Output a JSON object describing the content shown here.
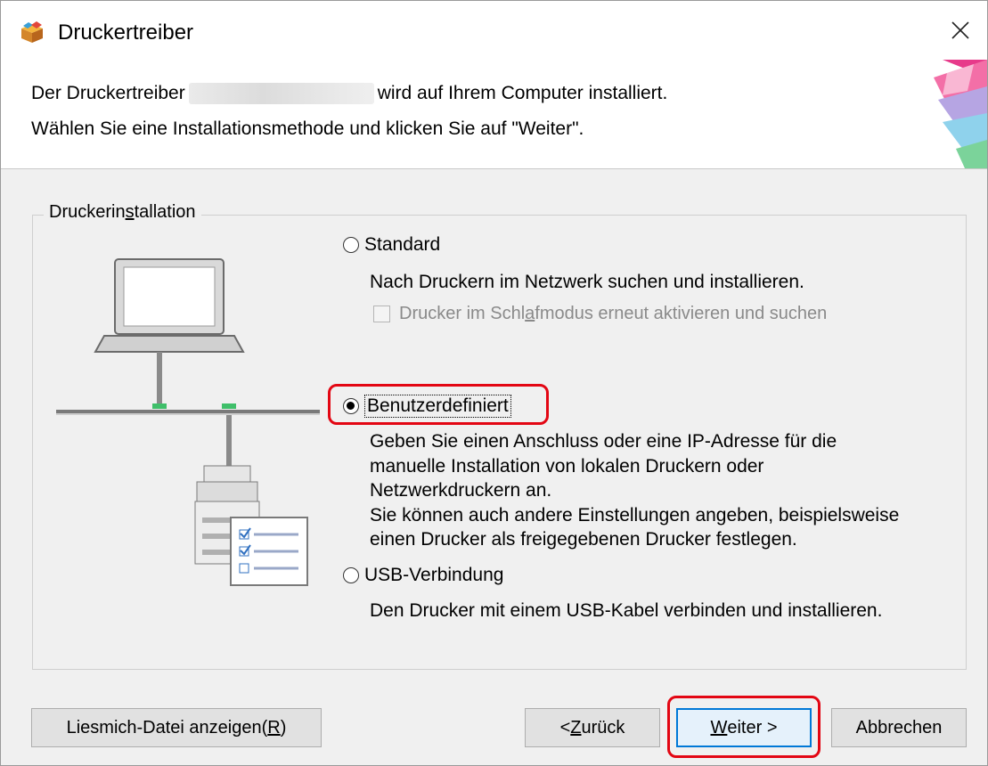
{
  "window": {
    "title": "Druckertreiber",
    "close_glyph": "×"
  },
  "header": {
    "line1_before": "Der Druckertreiber",
    "line1_after": "wird auf Ihrem Computer installiert.",
    "line2": "Wählen Sie eine Installationsmethode und klicken Sie auf \"Weiter\"."
  },
  "group": {
    "label_pre": "Druckerin",
    "label_mnemonic": "s",
    "label_post": "tallation",
    "options": [
      {
        "label": "Standard",
        "selected": false,
        "description": [
          "Nach Druckern im Netzwerk suchen und installieren."
        ],
        "checkbox": {
          "label_pre": "Drucker im Schl",
          "label_mnemonic": "a",
          "label_post": "fmodus erneut aktivieren und suchen",
          "checked": false,
          "enabled": false
        }
      },
      {
        "label": "Benutzerdefiniert",
        "selected": true,
        "description": [
          "Geben Sie einen Anschluss oder eine IP-Adresse für die",
          "manuelle Installation von lokalen Druckern oder",
          "Netzwerkdruckern an.",
          "Sie können auch andere Einstellungen angeben, beispielsweise",
          "einen Drucker als freigegebenen Drucker festlegen."
        ]
      },
      {
        "label": "USB-Verbindung",
        "selected": false,
        "description": [
          "Den Drucker mit einem USB-Kabel verbinden und installieren."
        ]
      }
    ]
  },
  "buttons": {
    "readme_pre": "Liesmich-Datei anzeigen(",
    "readme_mnemonic": "R",
    "readme_post": ")",
    "back_pre": "< ",
    "back_mnemonic": "Z",
    "back_post": "urück",
    "next_mnemonic": "W",
    "next_post": "eiter >",
    "cancel": "Abbrechen"
  },
  "colors": {
    "highlight": "#e30613",
    "focus_blue": "#0078d7",
    "dialog_bg": "#f0f0f0"
  },
  "icons": [
    "installer-box-icon",
    "close-icon",
    "network-diagram-illustration"
  ]
}
